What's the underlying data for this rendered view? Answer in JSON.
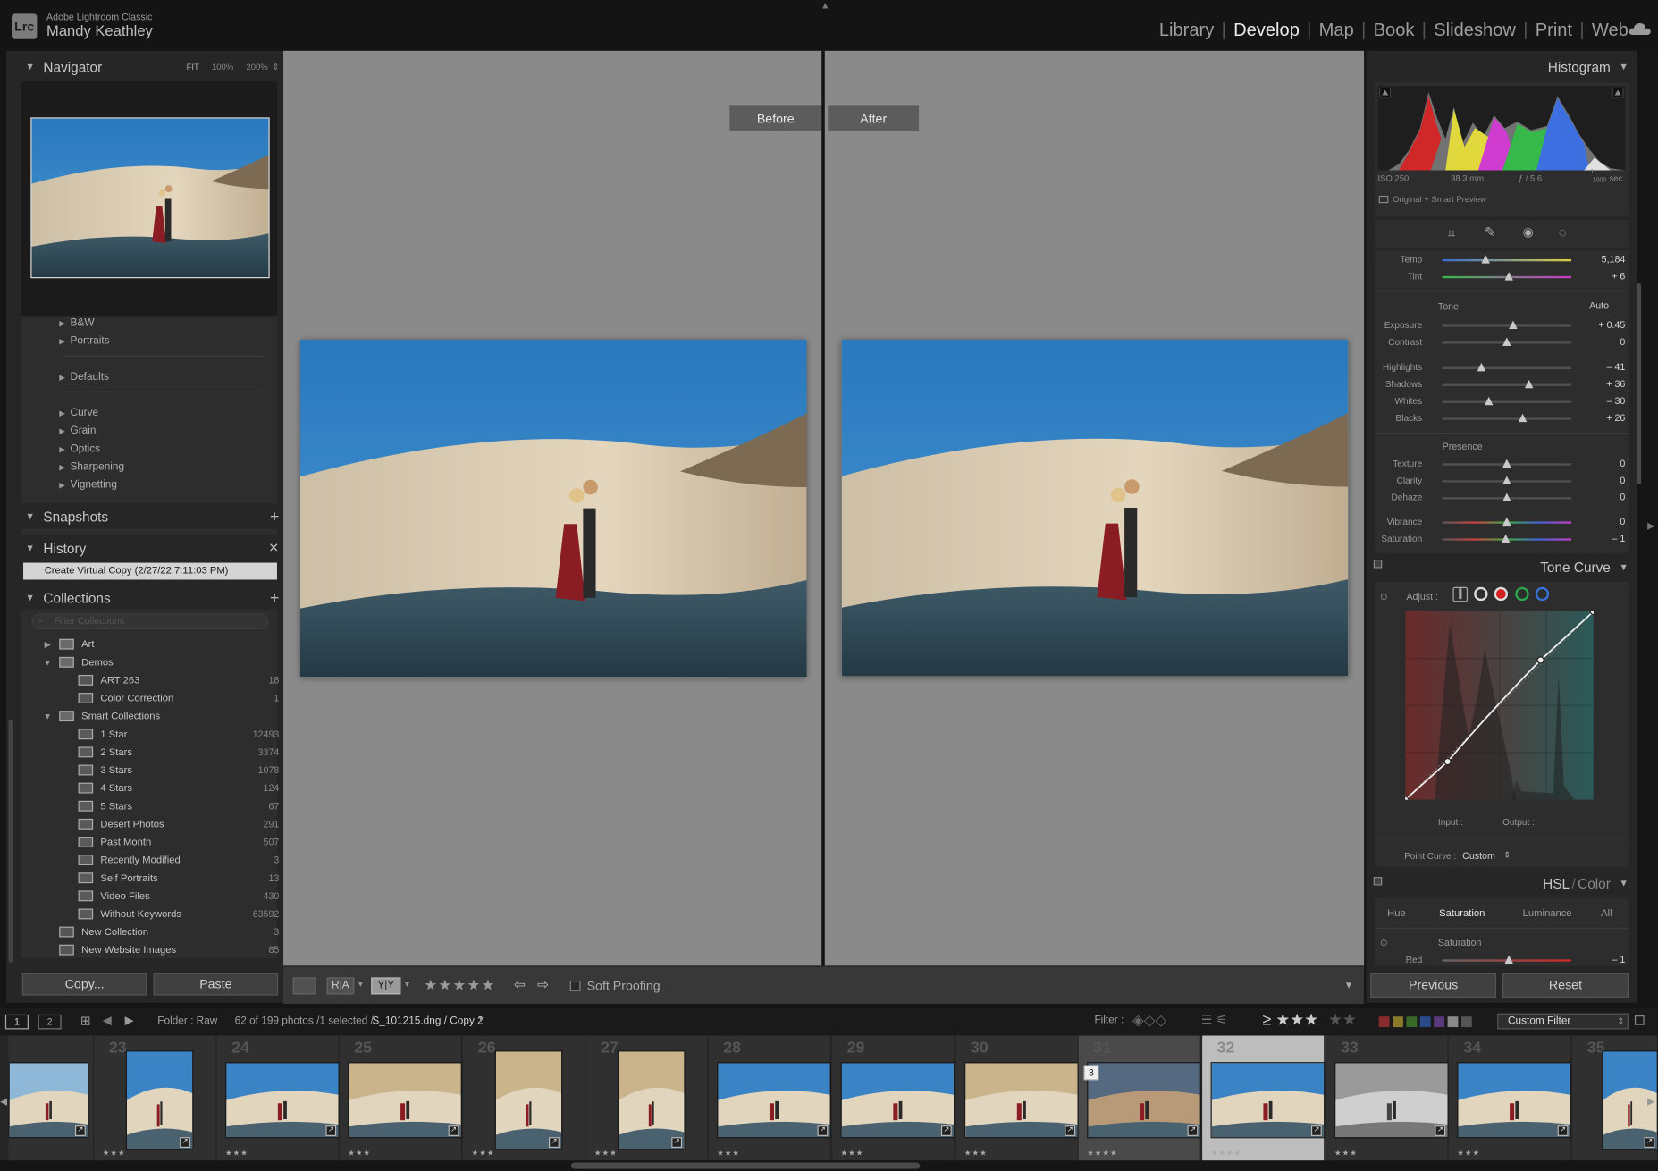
{
  "app": {
    "logo": "Lrc",
    "name": "Adobe Lightroom Classic",
    "user": "Mandy Keathley"
  },
  "modules": [
    {
      "label": "Library",
      "active": false
    },
    {
      "label": "Develop",
      "active": true
    },
    {
      "label": "Map",
      "active": false
    },
    {
      "label": "Book",
      "active": false
    },
    {
      "label": "Slideshow",
      "active": false
    },
    {
      "label": "Print",
      "active": false
    },
    {
      "label": "Web",
      "active": false
    }
  ],
  "left": {
    "navigator": {
      "title": "Navigator",
      "zoom": [
        "FIT",
        "100%",
        "200%"
      ]
    },
    "presets": [
      "B&W",
      "Portraits",
      "Defaults",
      "Curve",
      "Grain",
      "Optics",
      "Sharpening",
      "Vignetting"
    ],
    "snapshots": {
      "title": "Snapshots"
    },
    "history": {
      "title": "History",
      "item": "Create Virtual Copy (2/27/22 7:11:03 PM)"
    },
    "collections": {
      "title": "Collections",
      "filter_placeholder": "Filter Collections",
      "items": [
        {
          "name": "Art",
          "count": "",
          "level": 1,
          "type": "set",
          "expanded": false
        },
        {
          "name": "Demos",
          "count": "",
          "level": 1,
          "type": "set",
          "expanded": true
        },
        {
          "name": "ART 263",
          "count": "18",
          "level": 2,
          "type": "coll"
        },
        {
          "name": "Color Correction",
          "count": "1",
          "level": 2,
          "type": "coll"
        },
        {
          "name": "Smart Collections",
          "count": "",
          "level": 1,
          "type": "set",
          "expanded": true
        },
        {
          "name": "1 Star",
          "count": "12493",
          "level": 2,
          "type": "smart"
        },
        {
          "name": "2 Stars",
          "count": "3374",
          "level": 2,
          "type": "smart"
        },
        {
          "name": "3 Stars",
          "count": "1078",
          "level": 2,
          "type": "smart"
        },
        {
          "name": "4 Stars",
          "count": "124",
          "level": 2,
          "type": "smart"
        },
        {
          "name": "5 Stars",
          "count": "67",
          "level": 2,
          "type": "smart"
        },
        {
          "name": "Desert Photos",
          "count": "291",
          "level": 2,
          "type": "smart"
        },
        {
          "name": "Past Month",
          "count": "507",
          "level": 2,
          "type": "smart"
        },
        {
          "name": "Recently Modified",
          "count": "3",
          "level": 2,
          "type": "smart"
        },
        {
          "name": "Self Portraits",
          "count": "13",
          "level": 2,
          "type": "smart"
        },
        {
          "name": "Video Files",
          "count": "430",
          "level": 2,
          "type": "smart"
        },
        {
          "name": "Without Keywords",
          "count": "63592",
          "level": 2,
          "type": "smart"
        },
        {
          "name": "New Collection",
          "count": "3",
          "level": 1,
          "type": "coll"
        },
        {
          "name": "New Website Images",
          "count": "85",
          "level": 1,
          "type": "coll"
        }
      ]
    },
    "copy_label": "Copy...",
    "paste_label": "Paste"
  },
  "center": {
    "before_label": "Before",
    "after_label": "After",
    "toolbar": {
      "soft_proofing": "Soft Proofing",
      "ra": "R|A",
      "yy": "Y|Y",
      "rating": "★★★★★"
    }
  },
  "right": {
    "histogram": {
      "title": "Histogram",
      "iso": "ISO 250",
      "focal": "38.3 mm",
      "aperture": "ƒ / 5.6",
      "shutter_top": "1",
      "shutter_bottom": "1000",
      "shutter_unit": "sec",
      "preview": "Original + Smart Preview"
    },
    "basic": {
      "wb": [
        {
          "label": "Temp",
          "value": "5,184",
          "pos": 0.34
        },
        {
          "label": "Tint",
          "value": "+ 6",
          "pos": 0.52
        }
      ],
      "tone_title": "Tone",
      "auto_label": "Auto",
      "tone": [
        {
          "label": "Exposure",
          "value": "+ 0.45",
          "pos": 0.55
        },
        {
          "label": "Contrast",
          "value": "0",
          "pos": 0.5
        }
      ],
      "tone2": [
        {
          "label": "Highlights",
          "value": "– 41",
          "pos": 0.3
        },
        {
          "label": "Shadows",
          "value": "+ 36",
          "pos": 0.67
        },
        {
          "label": "Whites",
          "value": "– 30",
          "pos": 0.36
        },
        {
          "label": "Blacks",
          "value": "+ 26",
          "pos": 0.62
        }
      ],
      "presence_title": "Presence",
      "presence": [
        {
          "label": "Texture",
          "value": "0",
          "pos": 0.5
        },
        {
          "label": "Clarity",
          "value": "0",
          "pos": 0.5
        },
        {
          "label": "Dehaze",
          "value": "0",
          "pos": 0.5
        }
      ],
      "presence2": [
        {
          "label": "Vibrance",
          "value": "0",
          "pos": 0.5
        },
        {
          "label": "Saturation",
          "value": "– 1",
          "pos": 0.49
        }
      ]
    },
    "tone_curve": {
      "title": "Tone Curve",
      "adjust_label": "Adjust :",
      "input_label": "Input :",
      "output_label": "Output :",
      "point_curve_label": "Point Curve :",
      "point_curve_value": "Custom"
    },
    "hsl": {
      "title": "HSL",
      "title2": "Color",
      "tabs": [
        "Hue",
        "Saturation",
        "Luminance",
        "All"
      ],
      "active_tab": "Saturation",
      "section": "Saturation",
      "rows": [
        {
          "label": "Red",
          "value": "– 1",
          "pos": 0.52
        }
      ]
    },
    "previous_label": "Previous",
    "reset_label": "Reset"
  },
  "bottom": {
    "screen1": "1",
    "screen2": "2",
    "folder": "Folder : Raw",
    "count_text": "62 of 199 photos /1 selected /",
    "filename": "S_101215.dng / Copy 2",
    "filter_label": "Filter :",
    "rating_filter": "≥ ★★★",
    "custom_filter": "Custom Filter",
    "cells": [
      {
        "num": "",
        "stars": "",
        "portrait": false,
        "selected": false,
        "bw": false,
        "tone": "desert"
      },
      {
        "num": "23",
        "stars": "★★★",
        "portrait": true,
        "selected": false,
        "bw": false,
        "tone": "blue"
      },
      {
        "num": "24",
        "stars": "★★★",
        "portrait": false,
        "selected": false,
        "bw": false,
        "tone": "blue"
      },
      {
        "num": "25",
        "stars": "★★★",
        "portrait": false,
        "selected": false,
        "bw": false,
        "tone": "warm"
      },
      {
        "num": "26",
        "stars": "★★★",
        "portrait": true,
        "selected": false,
        "bw": false,
        "tone": "warm"
      },
      {
        "num": "27",
        "stars": "★★★",
        "portrait": true,
        "selected": false,
        "bw": false,
        "tone": "warm"
      },
      {
        "num": "28",
        "stars": "★★★",
        "portrait": false,
        "selected": false,
        "bw": false,
        "tone": "blue"
      },
      {
        "num": "29",
        "stars": "★★★",
        "portrait": false,
        "selected": false,
        "bw": false,
        "tone": "blue"
      },
      {
        "num": "30",
        "stars": "★★★",
        "portrait": false,
        "selected": false,
        "bw": false,
        "tone": "warm"
      },
      {
        "num": "31",
        "stars": "★★★★",
        "portrait": false,
        "selected": false,
        "bw": false,
        "tone": "dim",
        "badge": "3"
      },
      {
        "num": "32",
        "stars": "★★★★",
        "portrait": false,
        "selected": true,
        "bw": false,
        "tone": "blue"
      },
      {
        "num": "33",
        "stars": "★★★",
        "portrait": false,
        "selected": false,
        "bw": true,
        "tone": "bw"
      },
      {
        "num": "34",
        "stars": "★★★",
        "portrait": false,
        "selected": false,
        "bw": false,
        "tone": "blue"
      },
      {
        "num": "35",
        "stars": "",
        "portrait": true,
        "selected": false,
        "bw": false,
        "tone": "blue"
      }
    ]
  },
  "colors": {
    "accent": "#e8e8e8",
    "panel": "#262626",
    "canvas": "#8a8a8a",
    "sky": "#2f82c4",
    "sand": "#d6c7ae",
    "dress": "#8a1c24"
  }
}
